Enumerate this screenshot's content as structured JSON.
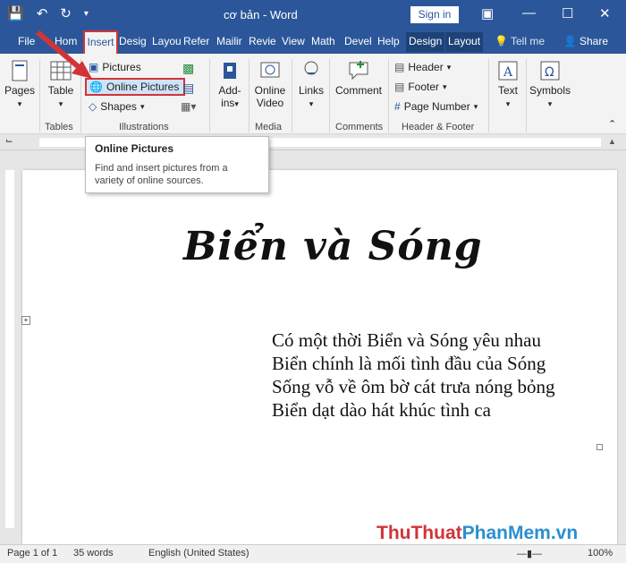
{
  "window": {
    "title": "cơ bản - Word",
    "signin_label": "Sign in"
  },
  "tabs": [
    "File",
    "Hom",
    "Insert",
    "Desig",
    "Layou",
    "Refer",
    "Mailir",
    "Revie",
    "View",
    "Math",
    "Devel",
    "Help",
    "Design",
    "Layout"
  ],
  "tell_me": "Tell me",
  "share": "Share",
  "ribbon": {
    "pages": "Pages",
    "table": "Table",
    "tables_group": "Tables",
    "pictures": "Pictures",
    "online_pictures": "Online Pictures",
    "shapes": "Shapes",
    "illustrations_group": "Illustrations",
    "addins_line1": "Add-",
    "addins_line2": "ins",
    "online_video_line1": "Online",
    "online_video_line2": "Video",
    "media_group": "Media",
    "links": "Links",
    "comment": "Comment",
    "comments_group": "Comments",
    "header": "Header",
    "footer": "Footer",
    "page_number": "Page Number",
    "header_footer_group": "Header & Footer",
    "text": "Text",
    "symbols": "Symbols"
  },
  "tooltip": {
    "title": "Online Pictures",
    "description": "Find and insert pictures from a variety of online sources."
  },
  "document": {
    "heading": "Biển và Sóng",
    "poem": [
      "Có một thời Biển và Sóng yêu nhau",
      "Biển chính là mối tình đầu của Sóng",
      "Sống vỗ về ôm bờ cát trưa nóng bỏng",
      "Biển dạt dào hát khúc tình ca"
    ]
  },
  "status": {
    "page": "Page 1 of 1",
    "words": "35 words",
    "language": "English (United States)",
    "zoom": "100%"
  },
  "watermark": {
    "part1": "Thu",
    "part2": "Thuat",
    "part3": "PhanMem",
    "part4": ".vn"
  },
  "colors": {
    "word_blue": "#2b579a",
    "highlight_red": "#d13438"
  }
}
